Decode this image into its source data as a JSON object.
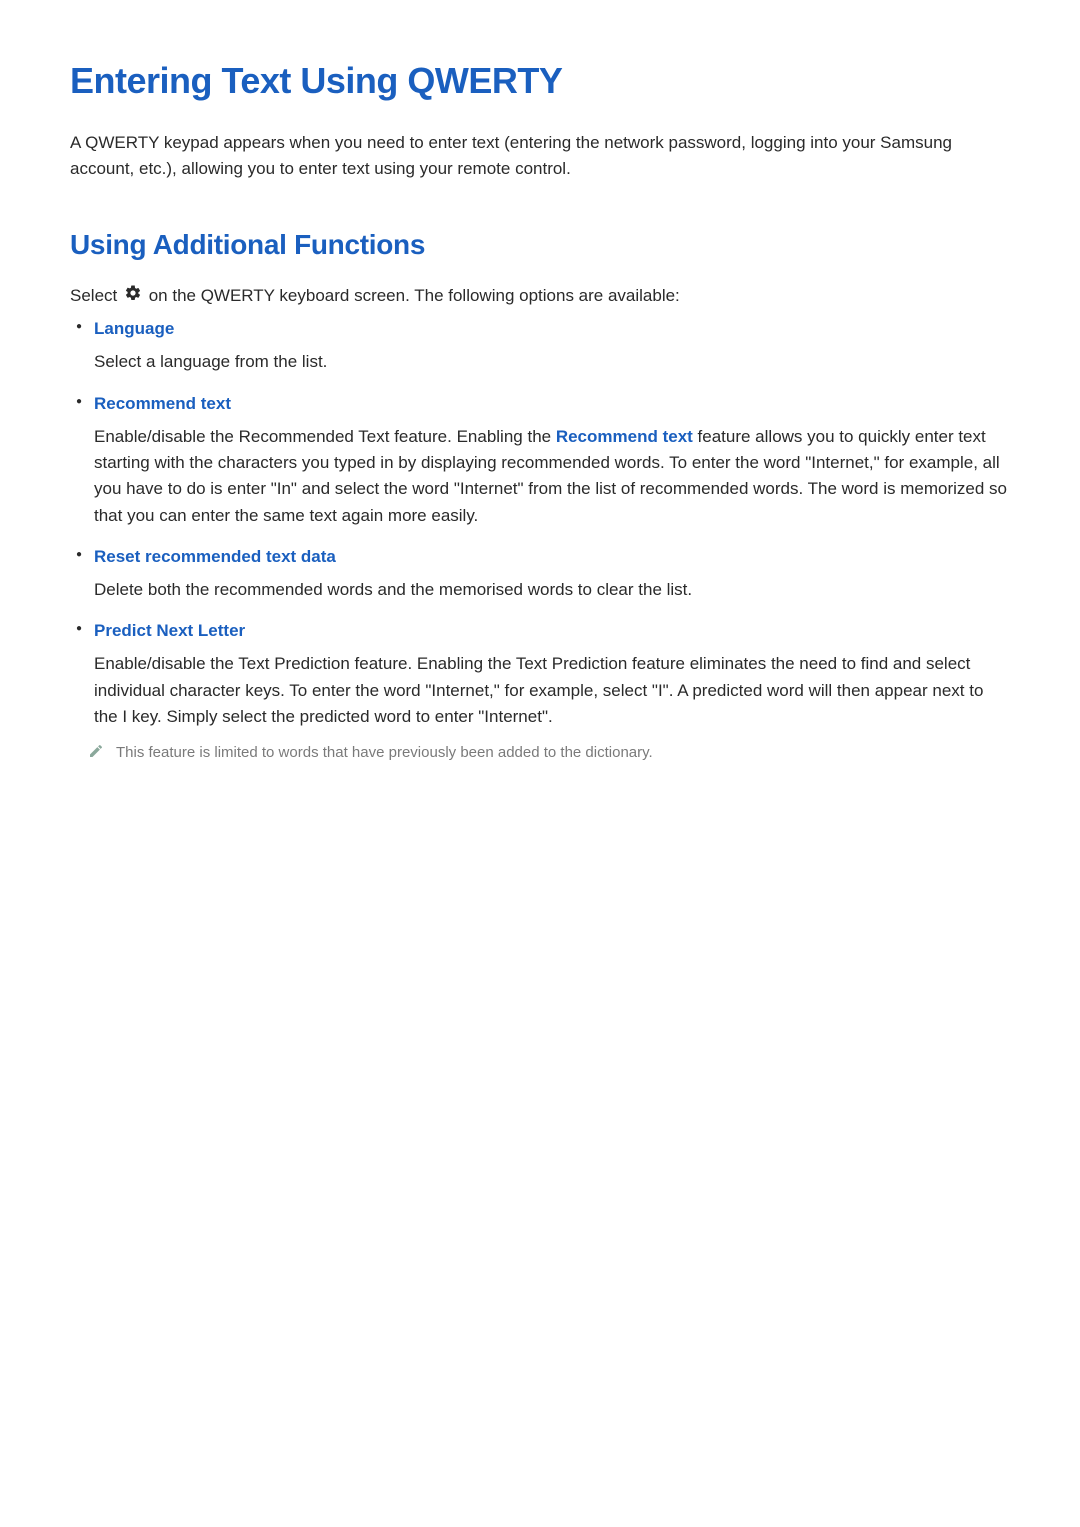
{
  "h1": "Entering Text Using QWERTY",
  "intro": "A QWERTY keypad appears when you need to enter text (entering the network password, logging into your Samsung account, etc.), allowing you to enter text using your remote control.",
  "h2": "Using Additional Functions",
  "select_pre": "Select ",
  "select_post": " on the QWERTY keyboard screen. The following options are available:",
  "items": [
    {
      "title": "Language",
      "body": "Select a language from the list."
    },
    {
      "title": "Recommend text",
      "body_pre": "Enable/disable the Recommended Text feature. Enabling the ",
      "body_em": "Recommend text",
      "body_post": " feature allows you to quickly enter text starting with the characters you typed in by displaying recommended words. To enter the word \"Internet,\" for example, all you have to do is enter \"In\" and select the word \"Internet\" from the list of recommended words. The word is memorized so that you can enter the same text again more easily."
    },
    {
      "title": "Reset recommended text data",
      "body": "Delete both the recommended words and the memorised words to clear the list."
    },
    {
      "title": "Predict Next Letter",
      "body": "Enable/disable the Text Prediction feature. Enabling the Text Prediction feature eliminates the need to find and select individual character keys. To enter the word \"Internet,\" for example, select \"I\". A predicted word will then appear next to the I key. Simply select the predicted word to enter \"Internet\".",
      "note": "This feature is limited to words that have previously been added to the dictionary."
    }
  ]
}
